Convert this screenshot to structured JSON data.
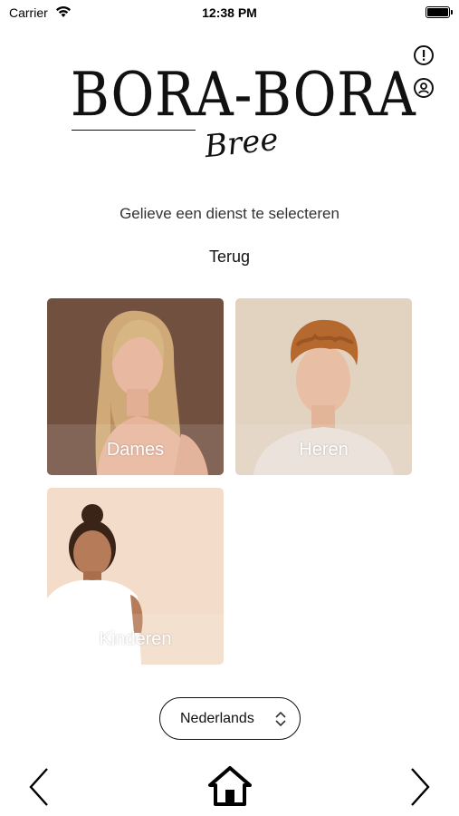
{
  "status_bar": {
    "carrier": "Carrier",
    "time": "12:38 PM"
  },
  "header": {
    "icons": [
      "info-icon",
      "account-icon"
    ],
    "logo_main": "BORA-BORA",
    "logo_sub": "Bree"
  },
  "main": {
    "subtitle": "Gelieve een dienst te selecteren",
    "back_label": "Terug",
    "services": [
      {
        "label": "Dames",
        "bg": "#7a5646"
      },
      {
        "label": "Heren",
        "bg": "#e2d2c0"
      },
      {
        "label": "Kinderen",
        "bg": "#f3dcc9"
      }
    ]
  },
  "language": {
    "selected": "Nederlands"
  },
  "bottom_nav": {
    "icons": [
      "back-chevron-icon",
      "home-icon",
      "forward-chevron-icon"
    ]
  }
}
